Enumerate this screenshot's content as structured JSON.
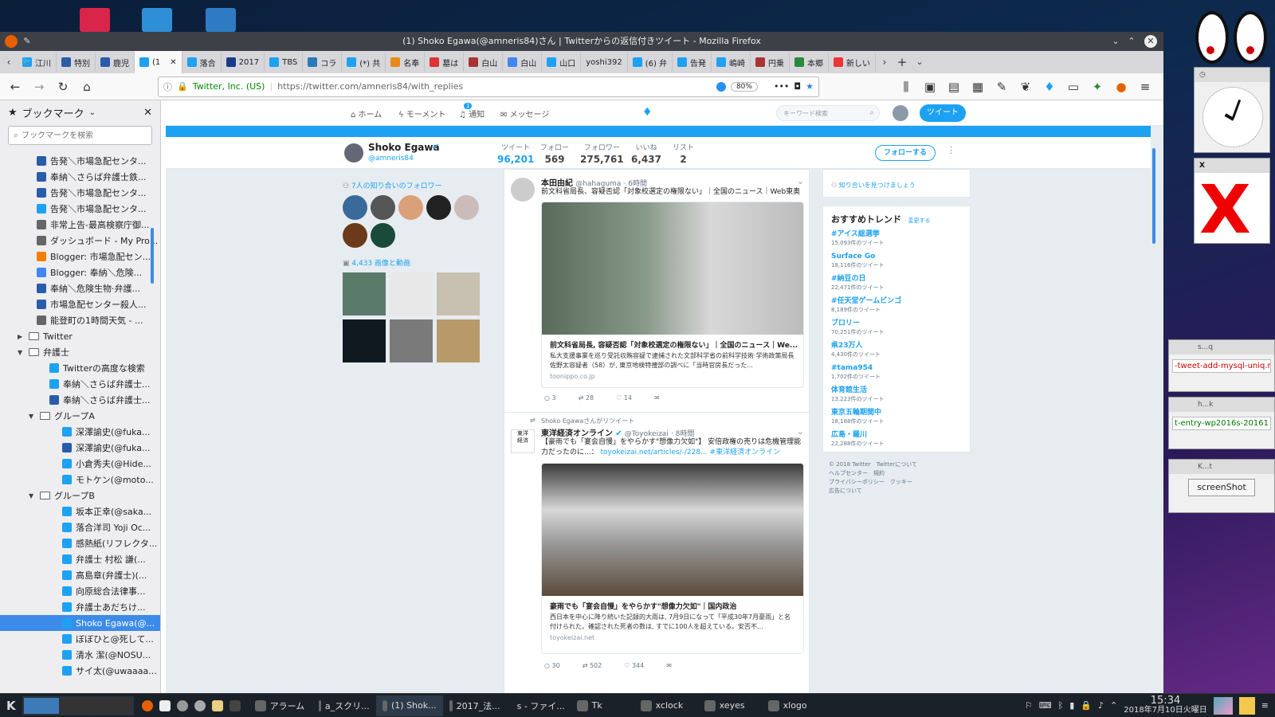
{
  "window": {
    "title": "(1) Shoko Egawa(@amneris84)さん | Twitterからの返信付きツイート - Mozilla Firefox"
  },
  "tabs": [
    {
      "label": "江川"
    },
    {
      "label": "特別"
    },
    {
      "label": "鹿児"
    },
    {
      "label": "(1"
    },
    {
      "label": "落合"
    },
    {
      "label": "2017"
    },
    {
      "label": "TBS"
    },
    {
      "label": "コラ"
    },
    {
      "label": "(*) 共"
    },
    {
      "label": "名奉"
    },
    {
      "label": "墓は"
    },
    {
      "label": "白山"
    },
    {
      "label": "白山"
    },
    {
      "label": "山口"
    },
    {
      "label": "yoshi392"
    },
    {
      "label": "(6) 弁"
    },
    {
      "label": "告発"
    },
    {
      "label": "嶋崎"
    },
    {
      "label": "円乗"
    },
    {
      "label": "本郷"
    },
    {
      "label": "新しい"
    }
  ],
  "nav": {
    "identity": "Twitter, Inc. (US)",
    "url": "https://twitter.com/amneris84/with_replies",
    "zoom": "80%"
  },
  "sidebar": {
    "title": "ブックマーク",
    "search_placeholder": "ブックマークを検索",
    "items": [
      {
        "label": "告発＼市場急配センタ..."
      },
      {
        "label": "奉納＼さらば弁護士鉄..."
      },
      {
        "label": "告発＼市場急配センタ..."
      },
      {
        "label": "告発＼市場急配センタ..."
      },
      {
        "label": "非常上告-最高検察庁御..."
      },
      {
        "label": "ダッシュボード - My Pro..."
      },
      {
        "label": "Blogger: 市場急配セン..."
      },
      {
        "label": "Blogger: 奉納＼危険..."
      },
      {
        "label": "奉納＼危険生物·弁護..."
      },
      {
        "label": "市場急配センター殺人..."
      },
      {
        "label": "能登町の1時間天気 - ..."
      },
      {
        "label": "Twitter"
      },
      {
        "label": "弁護士"
      },
      {
        "label": "Twitterの高度な検索"
      },
      {
        "label": "奉納＼さらば弁護士..."
      },
      {
        "label": "奉納＼さらば弁護士..."
      },
      {
        "label": "グループA"
      },
      {
        "label": "深澤諭史(@fuka..."
      },
      {
        "label": "深澤諭史(@fuka..."
      },
      {
        "label": "小倉秀夫(@Hide..."
      },
      {
        "label": "モトケン(@moto..."
      },
      {
        "label": "グループB"
      },
      {
        "label": "坂本正幸(@saka..."
      },
      {
        "label": "落合洋司 Yoji Oc..."
      },
      {
        "label": "感熱紙(リフレクタ..."
      },
      {
        "label": "弁護士 村松 謙(..."
      },
      {
        "label": "高島章(弁護士)(..."
      },
      {
        "label": "向原総合法律事..."
      },
      {
        "label": "弁護士あだちけ..."
      },
      {
        "label": "Shoko Egawa(@..."
      },
      {
        "label": "ぼぼひと@死して..."
      },
      {
        "label": "清水 潔(@NOSU..."
      },
      {
        "label": "サイ太(@uwaaaa..."
      }
    ]
  },
  "twitter": {
    "nav": {
      "home": "ホーム",
      "moments": "モーメント",
      "notifications": "通知",
      "notif_count": "1",
      "messages": "メッセージ",
      "search_placeholder": "キーワード検索",
      "tweet_button": "ツイート"
    },
    "profile": {
      "name": "Shoko Egawa",
      "handle": "@amneris84",
      "follow_button": "フォローする"
    },
    "stats": [
      {
        "label": "ツイート",
        "value": "96,201"
      },
      {
        "label": "フォロー",
        "value": "569"
      },
      {
        "label": "フォロワー",
        "value": "275,761"
      },
      {
        "label": "いいね",
        "value": "6,437"
      },
      {
        "label": "リスト",
        "value": "2"
      }
    ],
    "followers_known": "7人の知り合いのフォロワー",
    "media_count": "4,433 画像と動画",
    "tweets": [
      {
        "author": "本田由紀",
        "handle": "@hahaguma",
        "time": "· 6時間",
        "text": "前文科省局長、容疑否認「対象校選定の権限ない」｜全国のニュース｜Web東奥",
        "card_title": "前文科省局長, 容疑否認「対象校選定の権限ない」｜全国のニュース｜We...",
        "card_desc": "私大支援事業を巡り受託収賄容疑で逮捕された文部科学省の前科学技術·学術政策局長佐野太容疑者（58）が, 東京地検特捜部の調べに「当時官房長だった...",
        "card_domain": "toonippo.co.jp",
        "replies": "3",
        "retweets": "28",
        "likes": "14"
      },
      {
        "retweet_note": "Shoko Egawaさんがリツイート",
        "author": "東洋経済オンライン",
        "handle": "@Toyokeizai",
        "time": "· 8時間",
        "text": "【豪雨でも「宴会自慢」をやらかす\"想像力欠如\"】 安倍政権の売りは危機管理能力だったのに...：",
        "link": "toyokeizai.net/articles/-/228...",
        "hashtag": "#東洋経済オンライン",
        "card_title": "豪雨でも「宴会自慢」をやらかす\"想像力欠如\"｜国内政治",
        "card_desc": "西日本を中心に降り続いた記録的大雨は, 7月9日になって「平成30年7月豪雨」と名付けられた。確認された死者の数は, すでに100人を超えている。安否不...",
        "card_domain": "toyokeizai.net",
        "replies": "30",
        "retweets": "502",
        "likes": "344"
      }
    ],
    "find_friends": "知り合いを見つけましょう",
    "trends": {
      "title": "おすすめトレンド",
      "change": "· 変更する",
      "items": [
        {
          "name": "#アイス総選挙",
          "count": "15,093件のツイート"
        },
        {
          "name": "Surface Go",
          "count": "18,116件のツイート"
        },
        {
          "name": "#納豆の日",
          "count": "22,471件のツイート"
        },
        {
          "name": "#任天堂ゲームビンゴ",
          "count": "8,189件のツイート"
        },
        {
          "name": "ブロリー",
          "count": "70,251件のツイート"
        },
        {
          "name": "県23万人",
          "count": "4,430件のツイート"
        },
        {
          "name": "#tama954",
          "count": "1,702件のツイート"
        },
        {
          "name": "体育館生活",
          "count": "13,223件のツイート"
        },
        {
          "name": "東京五輪期間中",
          "count": "18,188件のツイート"
        },
        {
          "name": "広島・羅川",
          "count": "22,288件のツイート"
        }
      ]
    },
    "footer": [
      "© 2018 Twitter　Twitterについて",
      "ヘルプセンター　規約",
      "プライバシーポリシー　クッキー",
      "広告について"
    ]
  },
  "widgets": {
    "win1_title": "s...q",
    "win1_text": "-tweet-add-mysql-uniq.rb",
    "win2_title": "h...k",
    "win2_text": "t-entry-wp2016s-20161",
    "win3_title": "K...t",
    "win3_button": "screenShot"
  },
  "taskbar": {
    "items": [
      {
        "label": "アラーム"
      },
      {
        "label": "a_スクリ..."
      },
      {
        "label": "(1) Shok..."
      },
      {
        "label": "2017_法..."
      },
      {
        "label": "s - ファイ..."
      },
      {
        "label": "Tk"
      },
      {
        "label": "xclock"
      },
      {
        "label": "xeyes"
      },
      {
        "label": "xlogo"
      }
    ],
    "time": "15:34",
    "date": "2018年7月10日火曜日"
  }
}
